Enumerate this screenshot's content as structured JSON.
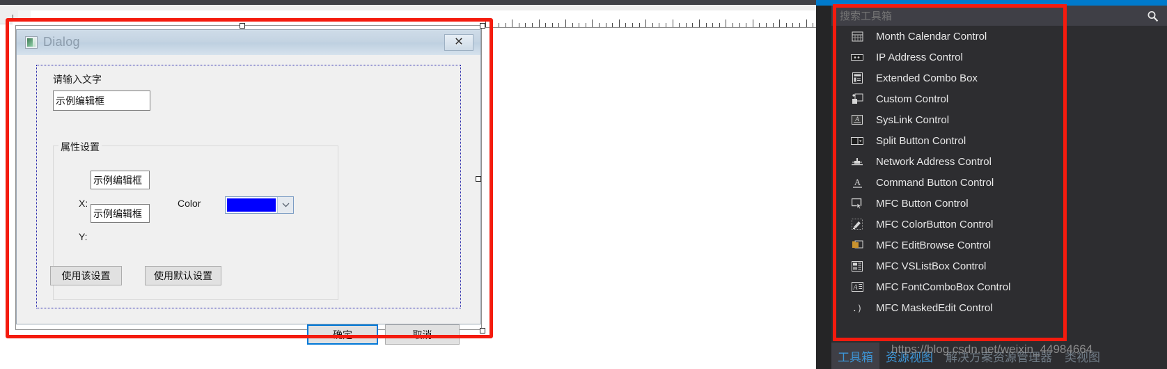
{
  "dialog": {
    "title": "Dialog",
    "icon": "dialog-icon",
    "close_label": "✕",
    "prompt_label": "请输入文字",
    "main_edit_value": "示例编辑框",
    "group_title": "属性设置",
    "x_label": "X:",
    "x_value": "示例编辑框",
    "y_label": "Y:",
    "y_value": "示例编辑框",
    "color_label": "Color",
    "color_value": "#0000ff",
    "apply_button": "使用该设置",
    "default_button": "使用默认设置",
    "ok_button": "确定",
    "cancel_button": "取消"
  },
  "toolbox": {
    "search_placeholder": "搜索工具箱",
    "search_value": "",
    "search_icon": "search-icon",
    "items": [
      {
        "label": "Month Calendar Control",
        "icon": "month-calendar-icon"
      },
      {
        "label": "IP Address Control",
        "icon": "ip-address-icon"
      },
      {
        "label": "Extended Combo Box",
        "icon": "extended-combo-icon"
      },
      {
        "label": "Custom Control",
        "icon": "custom-control-icon"
      },
      {
        "label": "SysLink Control",
        "icon": "syslink-icon"
      },
      {
        "label": "Split Button Control",
        "icon": "split-button-icon"
      },
      {
        "label": "Network Address Control",
        "icon": "network-address-icon"
      },
      {
        "label": "Command Button Control",
        "icon": "command-button-icon"
      },
      {
        "label": "MFC Button Control",
        "icon": "mfc-button-icon"
      },
      {
        "label": "MFC ColorButton Control",
        "icon": "mfc-colorbutton-icon"
      },
      {
        "label": "MFC EditBrowse Control",
        "icon": "mfc-editbrowse-icon"
      },
      {
        "label": "MFC VSListBox Control",
        "icon": "mfc-vslistbox-icon"
      },
      {
        "label": "MFC FontComboBox Control",
        "icon": "mfc-fontcombobox-icon"
      },
      {
        "label": "MFC MaskedEdit Control",
        "icon": "mfc-maskededit-icon"
      }
    ],
    "tabs": [
      {
        "label": "工具箱",
        "active": true
      },
      {
        "label": "资源视图",
        "active": false
      },
      {
        "label": "解决方案资源管理器",
        "active": false
      },
      {
        "label": "类视图",
        "active": false
      }
    ]
  },
  "watermark": {
    "text": "https://blog.csdn.net/weixin_44984664"
  },
  "accents": {
    "annotation_red": "#f41b0e",
    "vs_blue": "#007acc",
    "default_button_blue": "#0078d7",
    "swatch_blue": "#0000ff"
  }
}
